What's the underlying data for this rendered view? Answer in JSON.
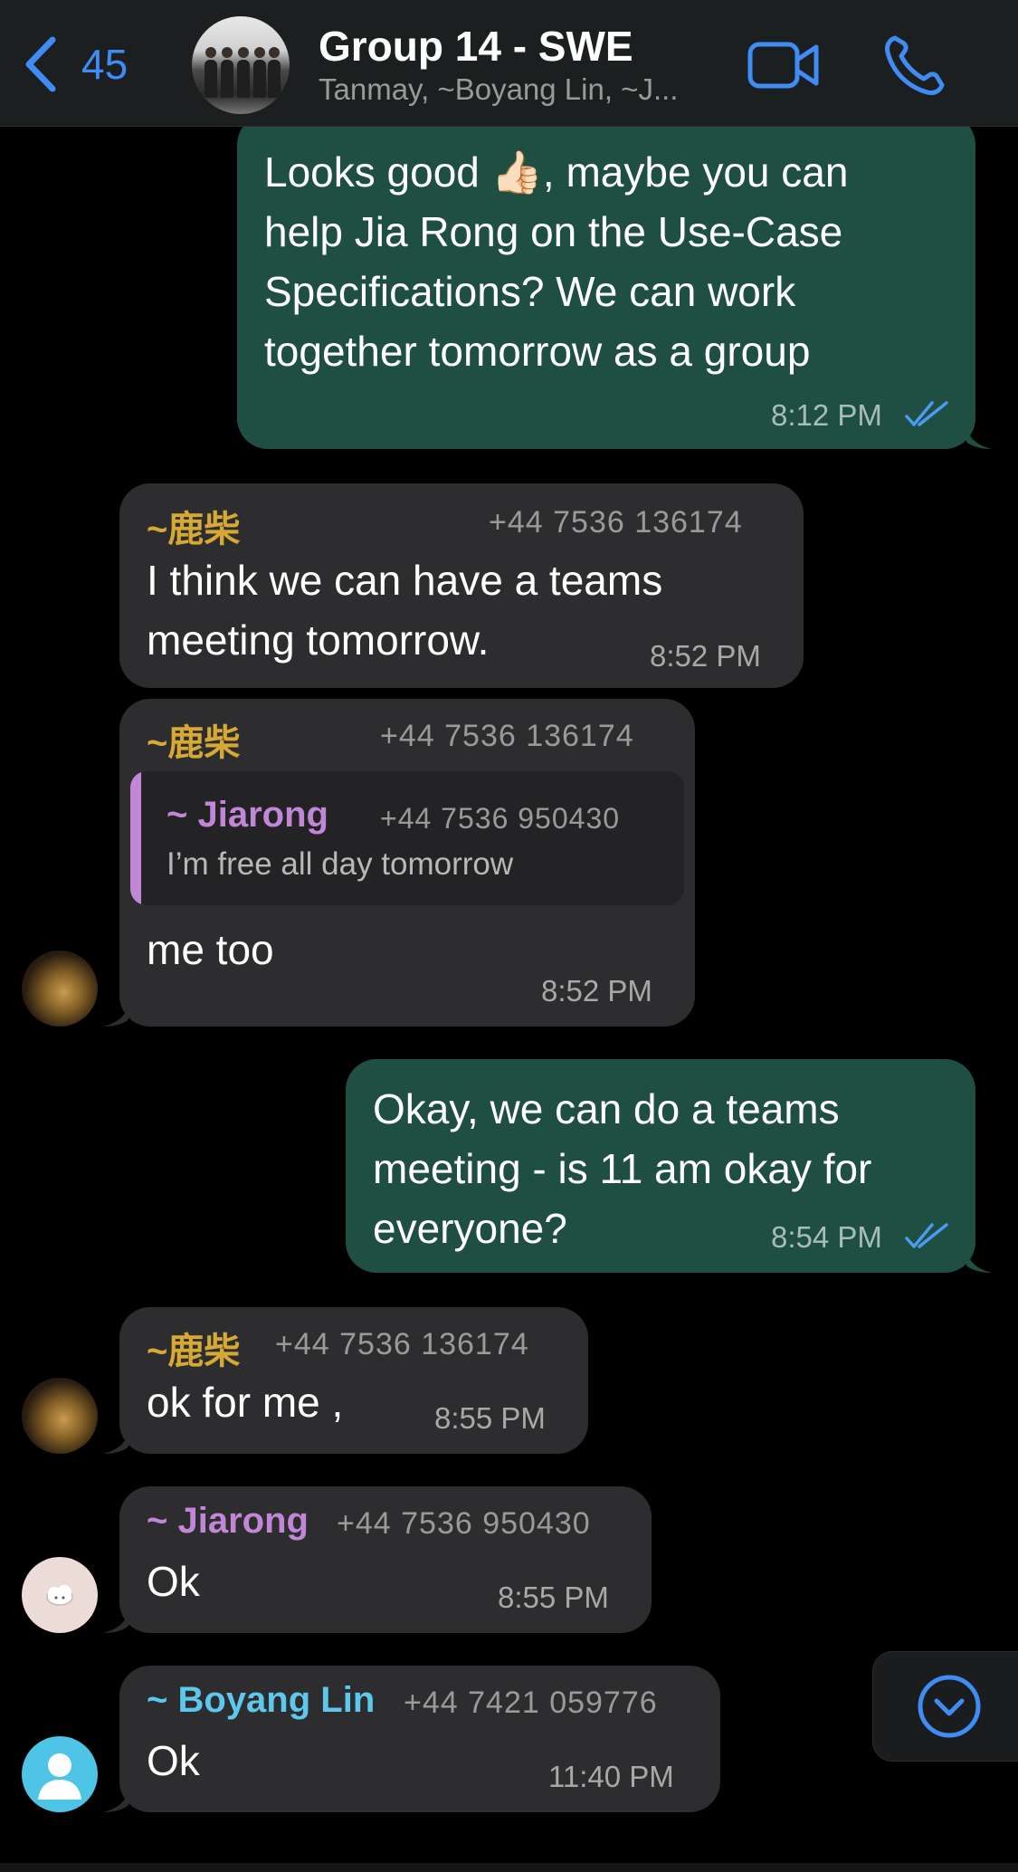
{
  "header": {
    "back_count": "45",
    "title": "Group 14 - SWE",
    "subtitle": "Tanmay, ~Boyang Lin, ~J...",
    "accent_color": "#3f8cf5",
    "icons": [
      "chevron-left-icon",
      "video-camera-icon",
      "phone-icon"
    ]
  },
  "messages": [
    {
      "direction": "outgoing",
      "lines": [
        "Looks good 👍🏻, maybe you can",
        "help Jia Rong on the Use-Case",
        "Specifications? We can work",
        "together tomorrow as a group"
      ],
      "time": "8:12 PM",
      "status": "read"
    },
    {
      "direction": "incoming",
      "sender": "~鹿柴",
      "phone": "+44 7536 136174",
      "lines": [
        "I think we can have a teams",
        "meeting tomorrow."
      ],
      "time": "8:52 PM"
    },
    {
      "direction": "incoming",
      "sender": "~鹿柴",
      "phone": "+44 7536 136174",
      "quote": {
        "sender": "~ Jiarong",
        "phone": "+44 7536 950430",
        "text": "I’m free all day tomorrow"
      },
      "lines": [
        "me too"
      ],
      "time": "8:52 PM"
    },
    {
      "direction": "outgoing",
      "lines": [
        "Okay, we can do a teams",
        "meeting - is 11 am okay for",
        "everyone?"
      ],
      "time": "8:54 PM",
      "status": "read"
    },
    {
      "direction": "incoming",
      "sender": "~鹿柴",
      "phone": "+44 7536 136174",
      "lines": [
        "ok for me ,"
      ],
      "time": "8:55 PM"
    },
    {
      "direction": "incoming",
      "sender": "~ Jiarong",
      "phone": "+44 7536 950430",
      "lines": [
        "Ok"
      ],
      "time": "8:55 PM"
    },
    {
      "direction": "incoming",
      "sender": "~ Boyang Lin",
      "phone": "+44 7421 059776",
      "lines": [
        "Ok"
      ],
      "time": "11:40 PM"
    }
  ],
  "colors": {
    "outgoing_bubble": "#1f4e43",
    "incoming_bubble": "#2d2d2f",
    "sender_lu_chai": "#d6a935",
    "sender_jiarong": "#c187d6",
    "sender_boyang": "#5ec7ec",
    "read_ticks": "#4b9cf0"
  },
  "scroll_button_icon": "chevron-down-circle-icon"
}
